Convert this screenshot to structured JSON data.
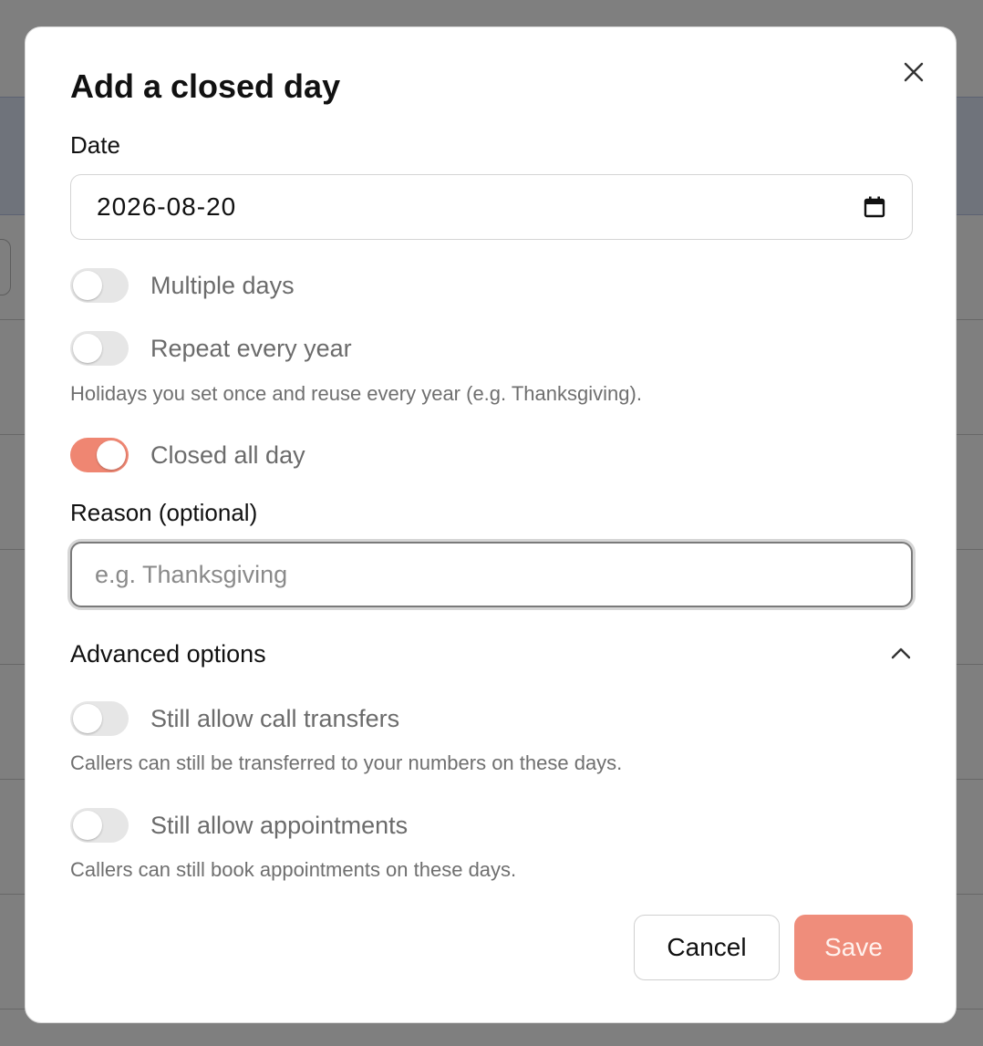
{
  "dialog": {
    "title": "Add a closed day",
    "date": {
      "label": "Date",
      "value": "2026-08-20"
    },
    "toggles": {
      "multiple_days": {
        "label": "Multiple days",
        "on": false
      },
      "repeat_every_year": {
        "label": "Repeat every year",
        "on": false,
        "help": "Holidays you set once and reuse every year (e.g. Thanksgiving)."
      },
      "closed_all_day": {
        "label": "Closed all day",
        "on": true
      }
    },
    "reason": {
      "label": "Reason (optional)",
      "value": "",
      "placeholder": "e.g. Thanksgiving"
    },
    "advanced": {
      "label": "Advanced options",
      "expanded": true,
      "call_transfers": {
        "label": "Still allow call transfers",
        "on": false,
        "help": "Callers can still be transferred to your numbers on these days."
      },
      "appointments": {
        "label": "Still allow appointments",
        "on": false,
        "help": "Callers can still book appointments on these days."
      }
    },
    "buttons": {
      "cancel": "Cancel",
      "save": "Save"
    }
  },
  "colors": {
    "accent": "#ef8672",
    "save_button": "#ef8d7b",
    "overlay": "rgba(0,0,0,0.5)"
  },
  "icons": {
    "close": "close-icon",
    "calendar": "calendar-icon",
    "collapse": "chevron-up-icon"
  }
}
